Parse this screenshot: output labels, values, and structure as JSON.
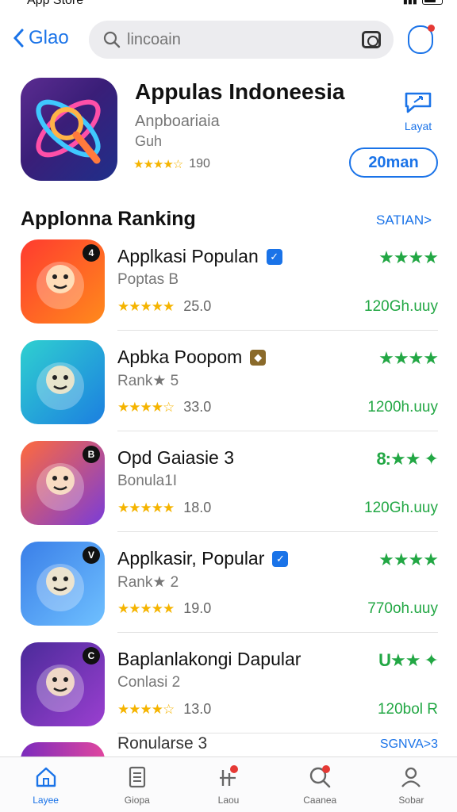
{
  "status": {
    "carrier": "App Store"
  },
  "nav": {
    "back_label": "Glao",
    "search_placeholder": "lincoain"
  },
  "featured": {
    "title": "Appulas Indoneesia",
    "subtitle": "Anpboariaia",
    "subtitle2": "Guh",
    "stars": "★★★★☆",
    "rating": "190",
    "share_label": "Layat",
    "get_label": "20man"
  },
  "section": {
    "title": "Applonna Ranking",
    "see_all": "SATIAN>"
  },
  "apps": [
    {
      "name": "Applkasi Populan",
      "sub": "Poptas B",
      "stars": "★★★★★",
      "rating": "25.0",
      "green": "★★★★",
      "count": "120Gh.uuy",
      "badge": "4",
      "verified": "blue",
      "icon": "dog-mascot-icon",
      "colors": [
        "#ff3b2f",
        "#ff8a1c"
      ]
    },
    {
      "name": "Apbka Poopom",
      "sub": "Rank★ 5",
      "stars": "★★★★☆",
      "rating": "33.0",
      "green": "★★★★",
      "count": "1200h.uuy",
      "badge": "",
      "verified": "gold",
      "icon": "rocket-icon",
      "colors": [
        "#2fd0d0",
        "#1c7fe0"
      ]
    },
    {
      "name": "Opd Gaiasie 3",
      "sub": "Bonula1I",
      "stars": "★★★★★",
      "rating": "18.0",
      "green": "8:★★ ✦",
      "count": "120Gh.uuy",
      "badge": "B",
      "verified": "",
      "icon": "rocket-ship-icon",
      "colors": [
        "#ff6a3d",
        "#7a3cd8"
      ]
    },
    {
      "name": "Applkasir, Popular",
      "sub": "Rank★ 2",
      "stars": "★★★★★",
      "rating": "19.0",
      "green": "★★★★",
      "count": "770oh.uuy",
      "badge": "V",
      "verified": "blue",
      "icon": "girl-avatar-icon",
      "colors": [
        "#3a7fe8",
        "#6fc0ff"
      ]
    },
    {
      "name": "Baplanlakongi Dapular",
      "sub": "Conlasi 2",
      "stars": "★★★★☆",
      "rating": "13.0",
      "green": "U★★ ✦",
      "count": "120bol R",
      "badge": "C",
      "verified": "",
      "icon": "businessman-avatar-icon",
      "colors": [
        "#4b2b9a",
        "#9a3fd0"
      ]
    }
  ],
  "partial": {
    "name": "Ronularse 3",
    "link": "SGNVA>3"
  },
  "tabs": [
    {
      "label": "Layee",
      "icon": "home-icon",
      "active": true
    },
    {
      "label": "Giopa",
      "icon": "document-icon",
      "active": false
    },
    {
      "label": "Laou",
      "icon": "chart-icon",
      "active": false
    },
    {
      "label": "Caanea",
      "icon": "search-icon",
      "active": false
    },
    {
      "label": "Sobar",
      "icon": "person-icon",
      "active": false
    }
  ]
}
